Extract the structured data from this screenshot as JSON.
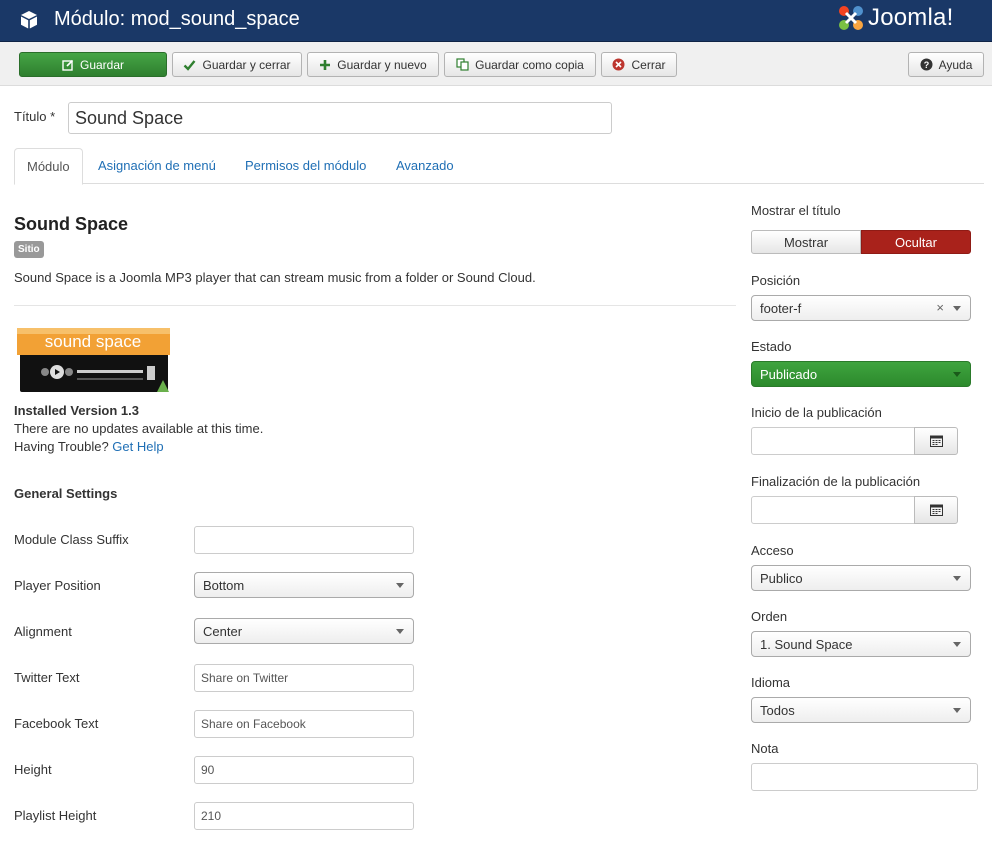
{
  "header": {
    "title": "Módulo: mod_sound_space",
    "logo_text": "Joomla!"
  },
  "toolbar": {
    "save_label": "Guardar",
    "save_close_label": "Guardar y cerrar",
    "save_new_label": "Guardar y nuevo",
    "save_copy_label": "Guardar como copia",
    "close_label": "Cerrar",
    "help_label": "Ayuda"
  },
  "title_field": {
    "label": "Título",
    "required_mark": "*",
    "value": "Sound Space"
  },
  "tabs": [
    {
      "label": "Módulo",
      "active": true
    },
    {
      "label": "Asignación de menú",
      "active": false
    },
    {
      "label": "Permisos del módulo",
      "active": false
    },
    {
      "label": "Avanzado",
      "active": false
    }
  ],
  "module": {
    "heading": "Sound Space",
    "badge": "Sitio",
    "description": "Sound Space is a Joomla MP3 player that can stream music from a folder or Sound Cloud.",
    "logo_text": "sound space",
    "installed": "Installed Version 1.3",
    "no_updates": "There are no updates available at this time.",
    "trouble": "Having Trouble?",
    "help_link": "Get Help",
    "general_settings": "General Settings"
  },
  "fields": {
    "class_suffix": {
      "label": "Module Class Suffix",
      "value": ""
    },
    "player_position": {
      "label": "Player Position",
      "value": "Bottom"
    },
    "alignment": {
      "label": "Alignment",
      "value": "Center"
    },
    "twitter_text": {
      "label": "Twitter Text",
      "value": "Share on Twitter"
    },
    "facebook_text": {
      "label": "Facebook Text",
      "value": "Share on Facebook"
    },
    "height": {
      "label": "Height",
      "value": "90"
    },
    "playlist_height": {
      "label": "Playlist Height",
      "value": "210"
    }
  },
  "sidebar": {
    "show_title": {
      "label": "Mostrar el título",
      "show": "Mostrar",
      "hide": "Ocultar",
      "selected": "Ocultar"
    },
    "position": {
      "label": "Posición",
      "value": "footer-f",
      "clear": "×"
    },
    "status": {
      "label": "Estado",
      "value": "Publicado"
    },
    "publish_up": {
      "label": "Inicio de la publicación",
      "value": ""
    },
    "publish_down": {
      "label": "Finalización de la publicación",
      "value": ""
    },
    "access": {
      "label": "Acceso",
      "value": "Publico"
    },
    "ordering": {
      "label": "Orden",
      "value": "1. Sound Space"
    },
    "language": {
      "label": "Idioma",
      "value": "Todos"
    },
    "note": {
      "label": "Nota",
      "value": ""
    }
  },
  "colors": {
    "header_bg": "#1a3867",
    "save_green": "#3a953a",
    "hide_red": "#a9221b",
    "link_blue": "#1f6fb5",
    "published_green": "#349934"
  }
}
